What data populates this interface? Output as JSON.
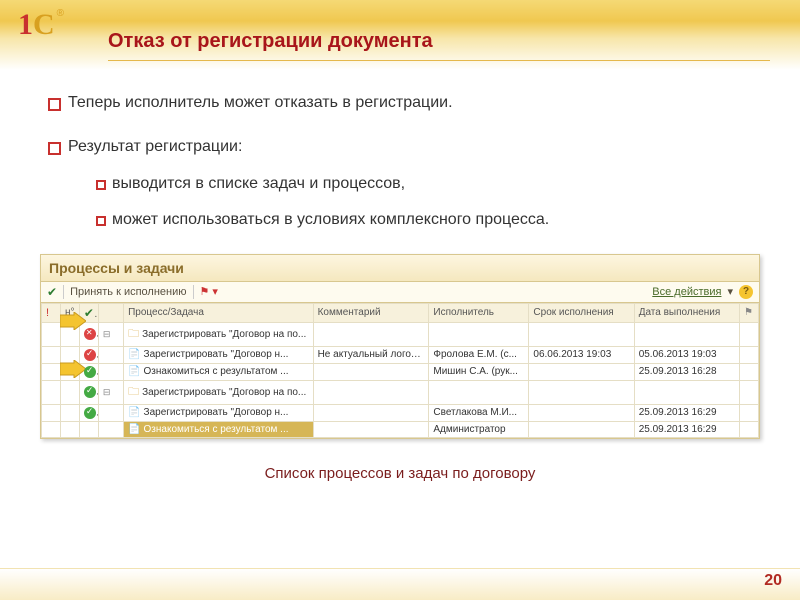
{
  "slide": {
    "title": "Отказ от регистрации документа",
    "page_number": "20"
  },
  "bullets": [
    "Теперь исполнитель может отказать в регистрации.",
    "Результат регистрации:"
  ],
  "sub_bullets": [
    "выводится в списке задач и процессов,",
    "может использоваться в условиях комплексного процесса."
  ],
  "panel": {
    "title": "Процессы и задачи",
    "toolbar": {
      "accept": "Принять к исполнению",
      "all_actions": "Все действия"
    },
    "columns": {
      "flag": "!",
      "indent": "н°",
      "task": "Процесс/Задача",
      "comment": "Комментарий",
      "executor": "Исполнитель",
      "due": "Срок исполнения",
      "done": "Дата выполнения"
    },
    "rows": [
      {
        "status": "red-cross",
        "tree": "expand",
        "icon": "folder",
        "task": "Зарегистрировать \"Договор на по...",
        "comment": "",
        "executor": "",
        "due": "",
        "done": "",
        "due_class": ""
      },
      {
        "status": "red-check",
        "tree": "",
        "icon": "doc",
        "task": "Зарегистрировать \"Договор н...",
        "comment": "Не актуальный логотип.",
        "executor": "Фролова Е.М. (с...",
        "due": "06.06.2013 19:03",
        "done": "05.06.2013 19:03",
        "due_class": "due-red"
      },
      {
        "status": "green-check",
        "tree": "",
        "icon": "doc",
        "task": "Ознакомиться с результатом ...",
        "comment": "",
        "executor": "Мишин С.А. (рук...",
        "due": "",
        "done": "25.09.2013 16:28",
        "due_class": ""
      },
      {
        "status": "green-check",
        "tree": "expand",
        "icon": "folder",
        "task": "Зарегистрировать \"Договор на по...",
        "comment": "",
        "executor": "",
        "due": "",
        "done": "",
        "due_class": ""
      },
      {
        "status": "green-check",
        "tree": "",
        "icon": "doc",
        "task": "Зарегистрировать \"Договор н...",
        "comment": "",
        "executor": "Светлакова М.И...",
        "due": "",
        "done": "25.09.2013 16:29",
        "due_class": ""
      },
      {
        "status": "",
        "tree": "",
        "icon": "doc",
        "task": "Ознакомиться с результатом ...",
        "comment": "",
        "executor": "Администратор",
        "due": "",
        "done": "25.09.2013 16:29",
        "due_class": "",
        "selected": true
      }
    ]
  },
  "caption": "Список процессов и задач по договору"
}
